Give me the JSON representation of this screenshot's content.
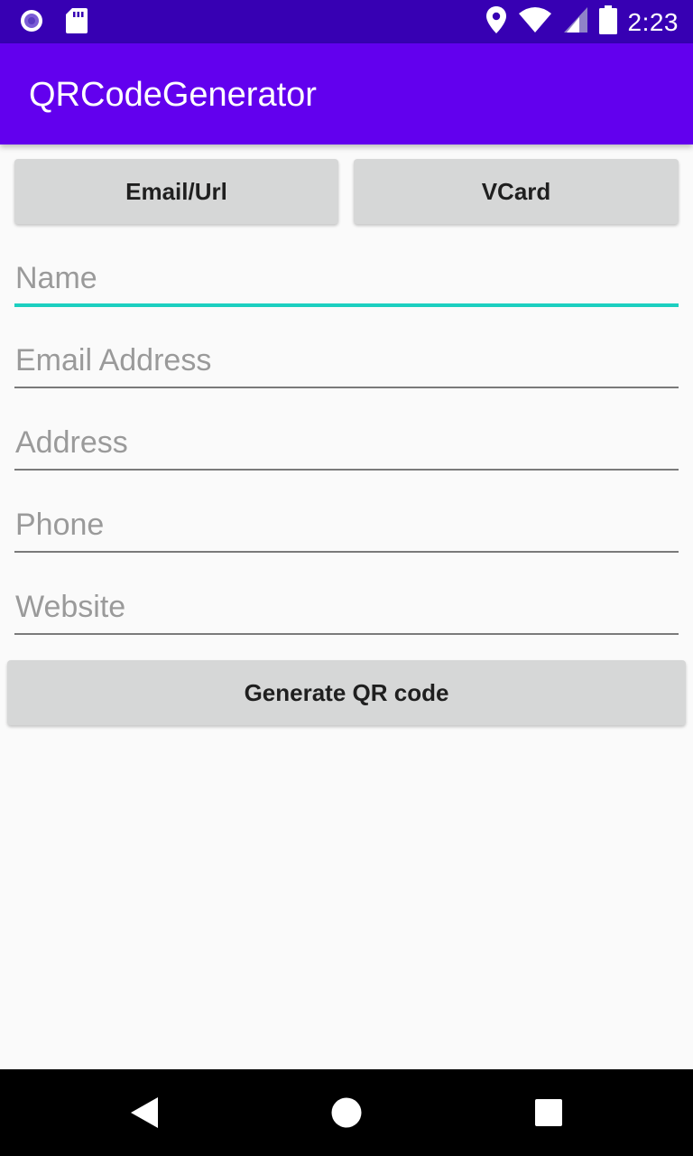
{
  "status_bar": {
    "time": "2:23",
    "icons": [
      "record-icon",
      "sd-card-icon",
      "location-icon",
      "wifi-icon",
      "cell-signal-icon",
      "battery-icon"
    ]
  },
  "app_bar": {
    "title": "QRCodeGenerator",
    "color": "#6200ee"
  },
  "tabs": {
    "email_url_label": "Email/Url",
    "vcard_label": "VCard"
  },
  "form": {
    "name_placeholder": "Name",
    "email_placeholder": "Email Address",
    "address_placeholder": "Address",
    "phone_placeholder": "Phone",
    "website_placeholder": "Website",
    "name_value": "",
    "email_value": "",
    "address_value": "",
    "phone_value": "",
    "website_value": ""
  },
  "actions": {
    "generate_label": "Generate QR code"
  },
  "navigation": {
    "icons": [
      "back-icon",
      "home-icon",
      "recents-icon"
    ]
  },
  "colors": {
    "status_bar": "#3700b3",
    "accent": "#1ccfc0",
    "button": "#d6d7d7"
  }
}
